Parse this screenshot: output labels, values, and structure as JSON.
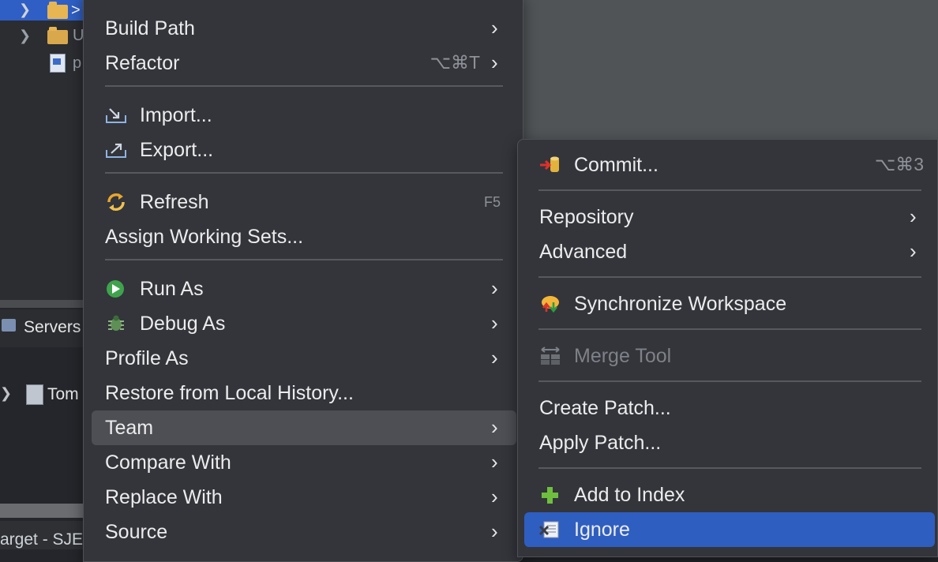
{
  "background": {
    "explorer_rows": [
      {
        "text": ">",
        "selected": true
      },
      {
        "text": "U",
        "selected": false
      },
      {
        "text": "p",
        "selected": false
      }
    ],
    "servers_tab": "Servers",
    "tomcat_text": "Tom",
    "status_text": "arget - SJE"
  },
  "context_menu": {
    "build_path": "Build Path",
    "refactor": "Refactor",
    "refactor_shortcut": "⌥⌘T",
    "import": "Import...",
    "export": "Export...",
    "refresh": "Refresh",
    "refresh_shortcut": "F5",
    "assign_working_sets": "Assign Working Sets...",
    "run_as": "Run As",
    "debug_as": "Debug As",
    "profile_as": "Profile As",
    "restore_history": "Restore from Local History...",
    "team": "Team",
    "compare_with": "Compare With",
    "replace_with": "Replace With",
    "source": "Source"
  },
  "team_submenu": {
    "commit": "Commit...",
    "commit_shortcut": "⌥⌘3",
    "repository": "Repository",
    "advanced": "Advanced",
    "synchronize": "Synchronize Workspace",
    "merge_tool": "Merge Tool",
    "create_patch": "Create Patch...",
    "apply_patch": "Apply Patch...",
    "add_to_index": "Add to Index",
    "ignore": "Ignore"
  },
  "icons": {
    "import": "import-icon",
    "export": "export-icon",
    "refresh": "refresh-icon",
    "run_as": "run-icon",
    "debug_as": "bug-icon",
    "commit": "commit-icon",
    "synchronize": "synchronize-icon",
    "merge_tool": "merge-icon",
    "add_to_index": "add-icon",
    "ignore": "ignore-icon"
  },
  "colors": {
    "menu_bg": "#33353b",
    "hover_bg": "#4d4f55",
    "selected_bg": "#2f5ec1",
    "disabled_text": "#7e8187",
    "shortcut_text": "#8e9197"
  }
}
